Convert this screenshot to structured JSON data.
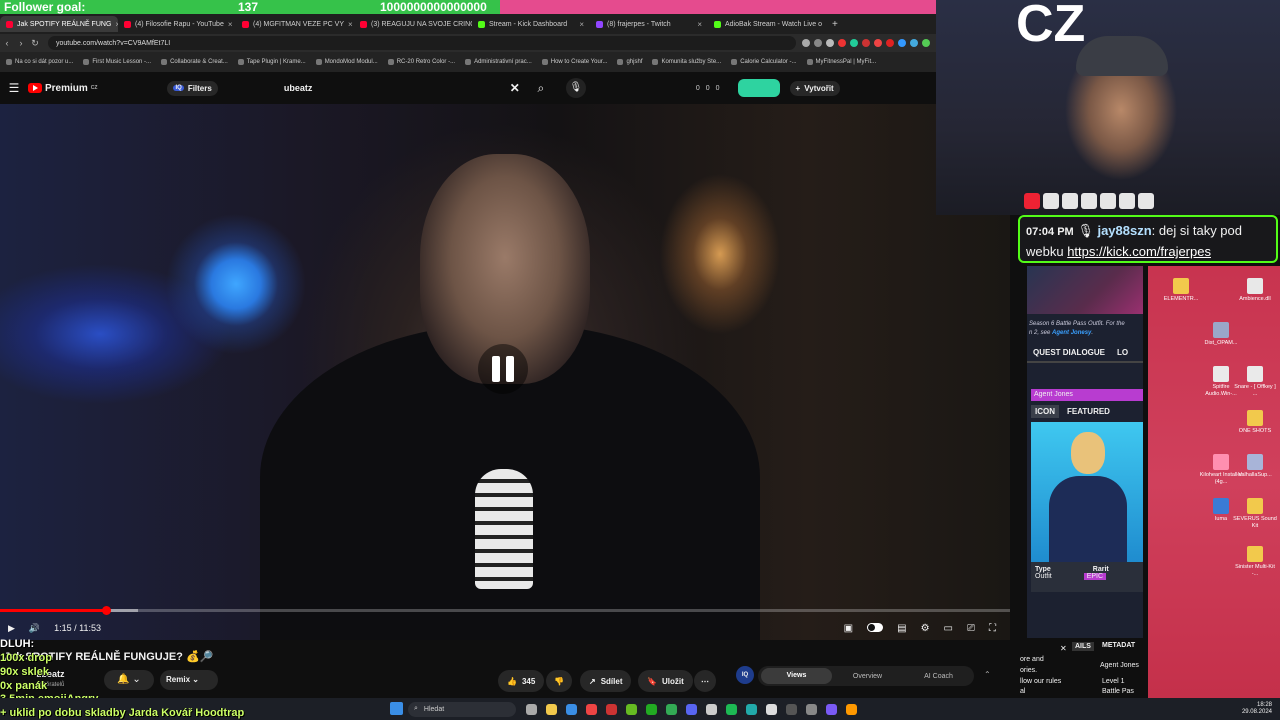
{
  "overlay": {
    "follower_goal_label": "Follower goal:",
    "follower_count": "137",
    "follower_target": "1000000000000000",
    "stream_lines": [
      "DLUH:",
      "100x drop",
      "90x sklek",
      "0x panák",
      "3.5min emojiAngry",
      "+ uklid po dobu skladby Jarda Kovář Hoodtrap"
    ]
  },
  "browser": {
    "tabs": [
      {
        "label": "Jak SPOTIFY REÁLNĚ FUNG",
        "color": "#ff0033",
        "active": true
      },
      {
        "label": "(4) Filosofie Rapu - YouTube",
        "color": "#ff0033",
        "active": false
      },
      {
        "label": "(4) MGFITMAN VEZE PC VY",
        "color": "#ff0033",
        "active": false
      },
      {
        "label": "(3) REAGUJU NA SVOJE CRING",
        "color": "#ff0033",
        "active": false
      },
      {
        "label": "Stream - Kick Dashboard",
        "color": "#53fc18",
        "active": false
      },
      {
        "label": "(8) frajerpes - Twitch",
        "color": "#9146ff",
        "active": false
      },
      {
        "label": "AdioBak Stream - Watch Live o",
        "color": "#53fc18",
        "active": false
      }
    ],
    "url": "youtube.com/watch?v=CV9AMfEt7LI",
    "bookmarks": [
      "Na co si dát pozor u...",
      "First Music Lesson -...",
      "Collaborate & Creat...",
      "Tape Plugin | Krame...",
      "MondoMod Modul...",
      "RC-20 Retro Color -...",
      "Administrativní prac...",
      "How to Create Your...",
      "ghjshf",
      "Komunita služby Ste...",
      "Calorie Calculator -...",
      "MyFitnessPal | MyFit..."
    ]
  },
  "youtube": {
    "logo": "Premium",
    "logo_region": "CZ",
    "filters_label": "Filters",
    "search_value": "ubeatz",
    "stats": [
      "0",
      "0",
      "0"
    ],
    "create_label": "Vytvořit",
    "player": {
      "time": "1:15 / 11:53",
      "progress": 0.105,
      "buffered": 0.137
    },
    "title": "Jak SPOTIFY REÁLNĚ FUNGUJE? 💰🔎",
    "channel": "ubeatz",
    "subscribers": "odběratelů",
    "remix_label": "Remix",
    "likes": "345",
    "share_label": "Sdílet",
    "save_label": "Uložit",
    "iq_tabs": [
      "Views",
      "Overview",
      "AI Coach"
    ],
    "iq_logo": "IQ"
  },
  "webcam": {
    "cz_label": "CZ"
  },
  "chat": {
    "time": "07:04 PM",
    "user": "jay88szn",
    "message_prefix": ": dej si taky pod webku ",
    "link": "https://kick.com/frajerpes"
  },
  "game_panel": {
    "text": "Season 6 Battle Pass Outfit. For the",
    "text2": "n 2, see",
    "link": "Agent Jonesy",
    "quest": "QUEST DIALOGUE",
    "quest_more": "LO",
    "agent_bar": "Agent Jones",
    "icon_tab": "ICON",
    "featured_tab": "FEATURED",
    "type_label": "Type",
    "rarity_label": "Rarit",
    "outfit": "Outfit",
    "epic": "EPIC"
  },
  "side_panel": {
    "tab": "AILS",
    "tab2": "METADAT",
    "lines": [
      "ore and",
      "ories.",
      "llow our rules",
      "al"
    ],
    "agent": "Agent Jones",
    "level": "Level 1",
    "battle": "Battle Pas"
  },
  "desktop_icons": [
    {
      "label": "ELEMENTR...",
      "color": "#f2c94c"
    },
    {
      "label": "Ambience.dll",
      "color": "#e8e8e8"
    },
    {
      "label": "Dist_OPAM...",
      "color": "#9aa7c9"
    },
    {
      "label": "Spitfire Audio.Win-...",
      "color": "#eaeaea"
    },
    {
      "label": "Snare - [ Offkey ] ...",
      "color": "#eaeaea"
    },
    {
      "label": "ONE SHOTS",
      "color": "#f2c94c"
    },
    {
      "label": "Kiloheart Installer (4g...",
      "color": "#ff8fb0"
    },
    {
      "label": "ValhallaSup...",
      "color": "#a8b4d8"
    },
    {
      "label": "Iuma",
      "color": "#3a7bd5"
    },
    {
      "label": "SEVERUS Sound Kit",
      "color": "#f2c94c"
    },
    {
      "label": "Sinister Multi-Kit -...",
      "color": "#f2c94c"
    }
  ],
  "taskbar": {
    "search_label": "Hledat",
    "time": "18:28",
    "date": "29.08.2024"
  }
}
